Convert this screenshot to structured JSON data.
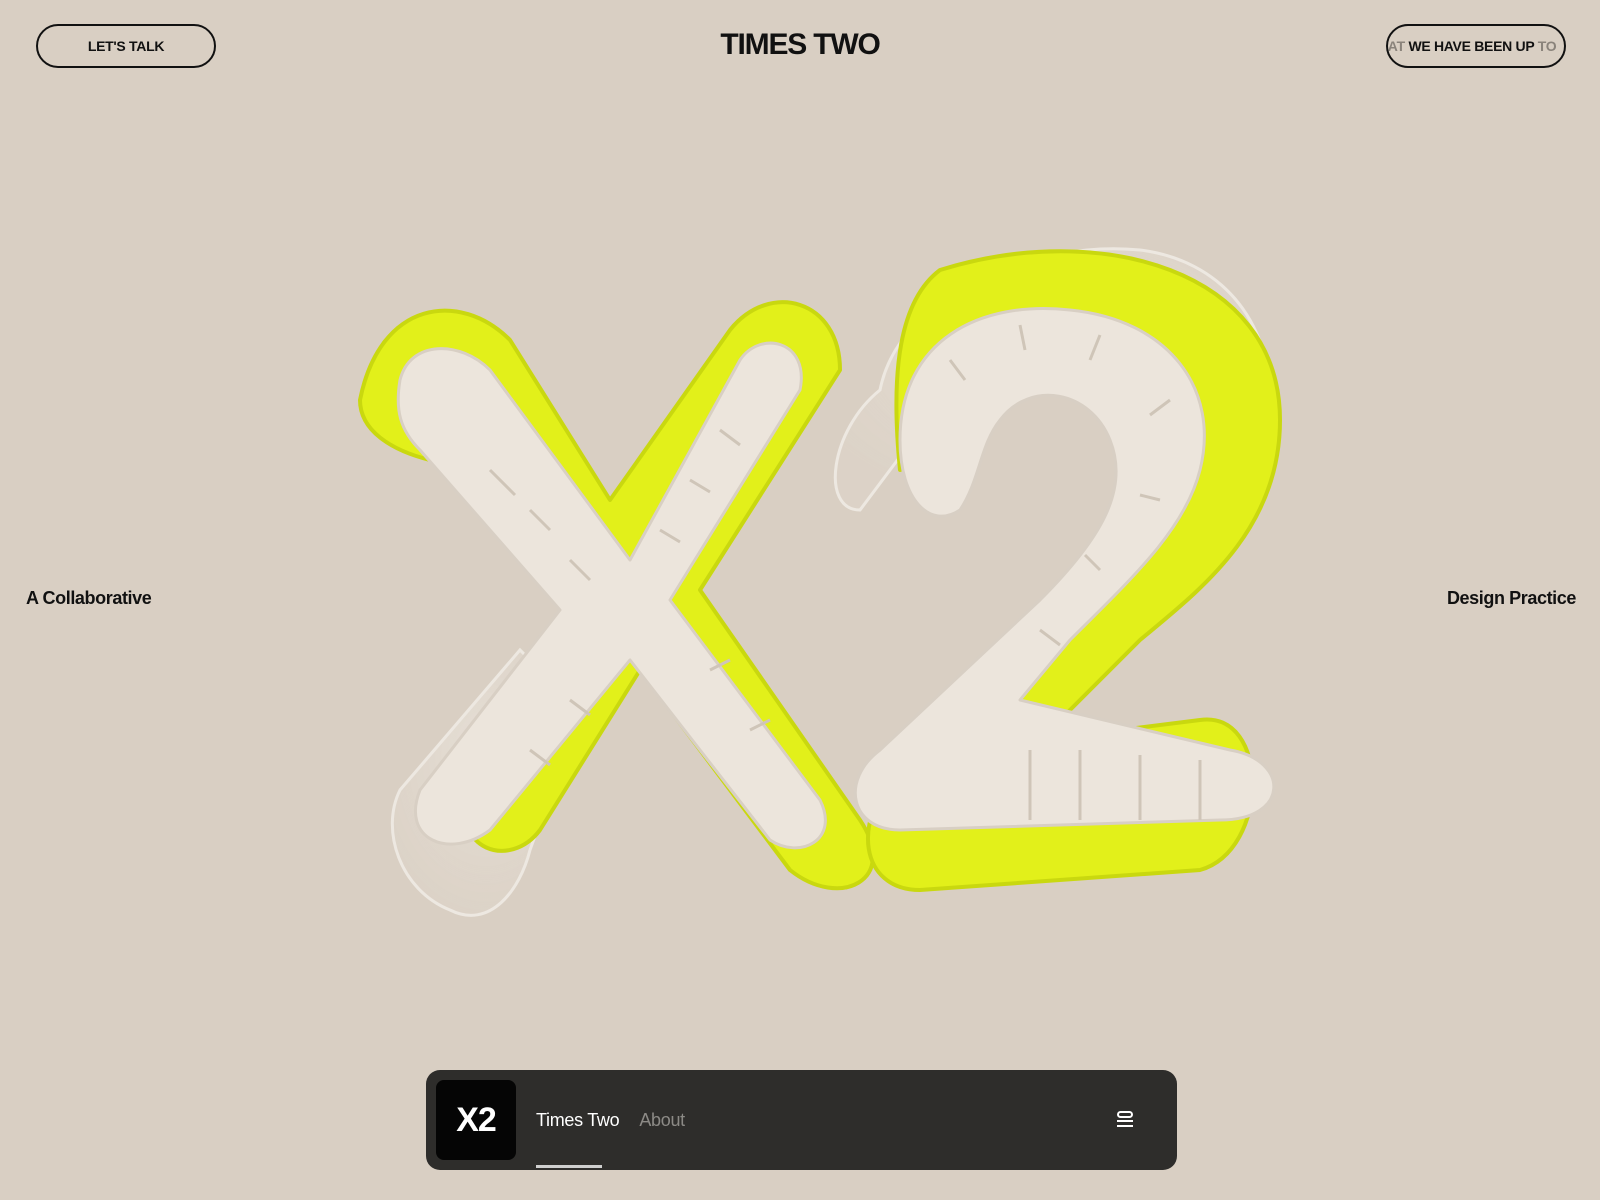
{
  "header": {
    "cta_label": "LET'S TALK",
    "title": "TIMES TWO",
    "marquee": {
      "lead": "HAT",
      "main": "WE HAVE BEEN UP",
      "tail": "TO"
    }
  },
  "hero": {
    "left_text": "A Collaborative",
    "right_text": "Design Practice",
    "colors": {
      "accent": "#e4f21a",
      "puff": "#ece5dc",
      "glass": "#efeae3"
    }
  },
  "navbar": {
    "logo_text": "X2",
    "items": [
      {
        "label": "Times Two",
        "active": true
      },
      {
        "label": "About",
        "active": false
      }
    ],
    "menu_icon": "menu-icon"
  },
  "colors": {
    "background": "#d9cfc3",
    "navbar": "#2e2d2b",
    "text": "#111111"
  }
}
